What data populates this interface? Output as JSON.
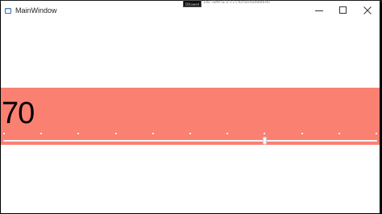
{
  "window": {
    "title": "MainWindow",
    "icon": "window-app-icon"
  },
  "caption_buttons": {
    "minimize_icon": "minimize-icon",
    "maximize_icon": "maximize-icon",
    "close_icon": "close-icon"
  },
  "debug_overlay": {
    "badge_text": "Dillowed",
    "trail_text": "EXE TEMP LE D 1:1 L  K0:60FH2H8HHFH0"
  },
  "slider": {
    "display_value": "70",
    "value": 70,
    "min": 0,
    "max": 100,
    "tick_count": 10,
    "tick_frequency": 10
  },
  "colors": {
    "panel_background": "#fa8072",
    "window_background": "#ffffff",
    "value_text": "#000000",
    "track": "#f4f4f4"
  }
}
